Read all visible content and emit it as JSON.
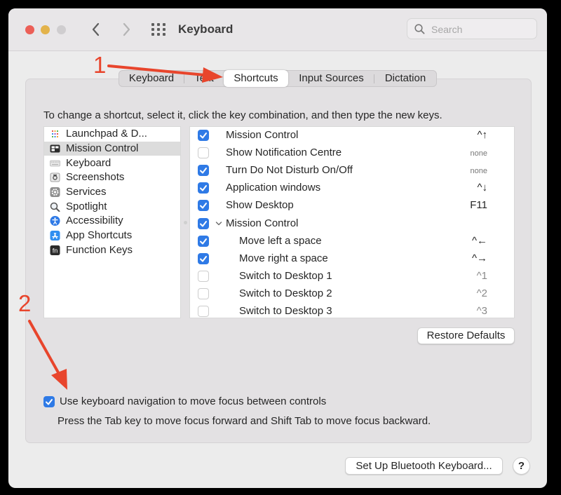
{
  "window": {
    "title": "Keyboard"
  },
  "search": {
    "placeholder": "Search"
  },
  "tabs": [
    {
      "label": "Keyboard"
    },
    {
      "label": "Text"
    },
    {
      "label": "Shortcuts"
    },
    {
      "label": "Input Sources"
    },
    {
      "label": "Dictation"
    }
  ],
  "instruction": "To change a shortcut, select it, click the key combination, and then type the new keys.",
  "categories": [
    {
      "label": "Launchpad & D...",
      "icon": "launchpad-icon"
    },
    {
      "label": "Mission Control",
      "icon": "mission-control-icon",
      "selected": true
    },
    {
      "label": "Keyboard",
      "icon": "keyboard-icon"
    },
    {
      "label": "Screenshots",
      "icon": "screenshot-icon"
    },
    {
      "label": "Services",
      "icon": "gear-icon"
    },
    {
      "label": "Spotlight",
      "icon": "magnifier-icon"
    },
    {
      "label": "Accessibility",
      "icon": "accessibility-icon"
    },
    {
      "label": "App Shortcuts",
      "icon": "app-store-icon"
    },
    {
      "label": "Function Keys",
      "icon": "fn-icon"
    }
  ],
  "shortcuts": [
    {
      "label": "Mission Control",
      "key": "^↑",
      "checked": true
    },
    {
      "label": "Show Notification Centre",
      "key": "none",
      "checked": false
    },
    {
      "label": "Turn Do Not Disturb On/Off",
      "key": "none",
      "checked": true
    },
    {
      "label": "Application windows",
      "key": "^↓",
      "checked": true
    },
    {
      "label": "Show Desktop",
      "key": "F11",
      "checked": true
    },
    {
      "label": "Mission Control",
      "key": "",
      "checked": true,
      "group": true
    },
    {
      "label": "Move left a space",
      "key": "^←",
      "checked": true
    },
    {
      "label": "Move right a space",
      "key": "^→",
      "checked": true
    },
    {
      "label": "Switch to Desktop 1",
      "key": "^1",
      "checked": false
    },
    {
      "label": "Switch to Desktop 2",
      "key": "^2",
      "checked": false
    },
    {
      "label": "Switch to Desktop 3",
      "key": "^3",
      "checked": false
    }
  ],
  "buttons": {
    "restore_defaults": "Restore Defaults",
    "bluetooth": "Set Up Bluetooth Keyboard...",
    "help": "?"
  },
  "keyboard_navigation": {
    "checked": true,
    "label": "Use keyboard navigation to move focus between controls",
    "hint": "Press the Tab key to move focus forward and Shift Tab to move focus backward."
  },
  "annotations": {
    "one": "1",
    "two": "2"
  },
  "colors": {
    "accent": "#2f7ae6",
    "annotation": "#e8452c",
    "close": "#ec5f57",
    "minimize": "#e3b34b"
  }
}
